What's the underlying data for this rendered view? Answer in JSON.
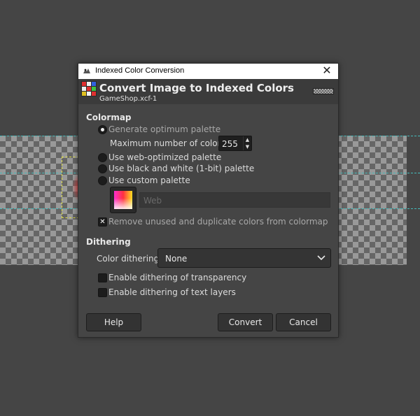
{
  "window": {
    "title": "Indexed Color Conversion",
    "close_glyph": "✕"
  },
  "header": {
    "title": "Convert Image to Indexed Colors",
    "subtitle": "GameShop.xcf-1"
  },
  "colormap": {
    "section_title": "Colormap",
    "generate_optimum": "Generate optimum palette",
    "max_colors_label": "Maximum number of colors:",
    "max_colors_value": "255",
    "web_optimized": "Use web-optimized palette",
    "black_white": "Use black and white (1-bit) palette",
    "custom_palette": "Use custom palette",
    "custom_palette_name": "Web",
    "remove_unused": "Remove unused and duplicate colors from colormap",
    "selected_option": "generate_optimum"
  },
  "dithering": {
    "section_title": "Dithering",
    "color_dithering_label": "Color dithering:",
    "color_dithering_value": "None",
    "transparency": "Enable dithering of transparency",
    "text_layers": "Enable dithering of text layers"
  },
  "buttons": {
    "help": "Help",
    "convert": "Convert",
    "cancel": "Cancel"
  },
  "colors": {
    "dialog_bg": "#454545",
    "header_bg": "#3b3b3b",
    "titlebar_bg": "#ffffff",
    "guide_line": "#44bbbb",
    "selection_outline": "#dddd44"
  }
}
